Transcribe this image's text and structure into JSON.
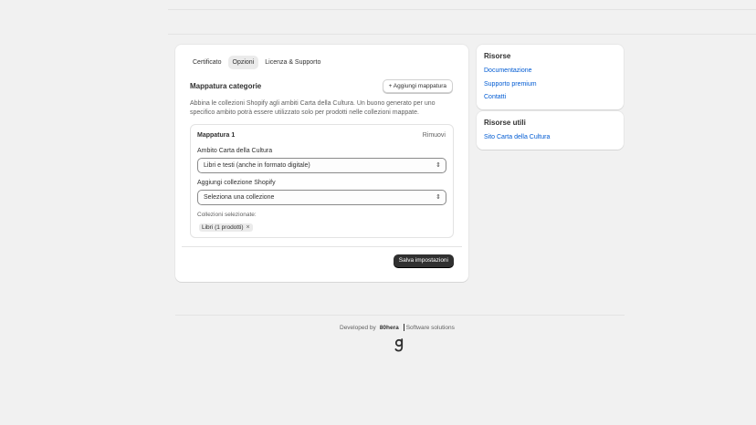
{
  "tabs": [
    {
      "label": "Certificato"
    },
    {
      "label": "Opzioni"
    },
    {
      "label": "Licenza & Supporto"
    }
  ],
  "main": {
    "title": "Mappatura categorie",
    "add_button": "+ Aggiungi mappatura",
    "description": "Abbina le collezioni Shopify agli ambiti Carta della Cultura. Un buono generato per uno specifico ambito potrà essere utilizzato solo per prodotti nelle collezioni mappate.",
    "mapping": {
      "title": "Mappatura 1",
      "remove": "Rimuovi",
      "ambito_label": "Ambito Carta della Cultura",
      "ambito_value": "Libri e testi (anche in formato digitale)",
      "collection_label": "Aggiungi collezione Shopify",
      "collection_value": "Seleziona una collezione",
      "selected_label": "Collezioni selezionate:",
      "chip": "Libri (1 prodotti)"
    },
    "save_button": "Salva impostazioni"
  },
  "resources": {
    "title": "Risorse",
    "links": [
      "Documentazione",
      "Supporto premium",
      "Contatti"
    ]
  },
  "utilities": {
    "title": "Risorse utili",
    "links": [
      "Sito Carta della Cultura"
    ]
  },
  "footer": {
    "developed_by": "Developed by",
    "brand": "80hera",
    "tagline": "Software solutions"
  },
  "colors": {
    "link": "#005bd3",
    "primary_button": "#303030",
    "background": "#f1f1f1"
  }
}
